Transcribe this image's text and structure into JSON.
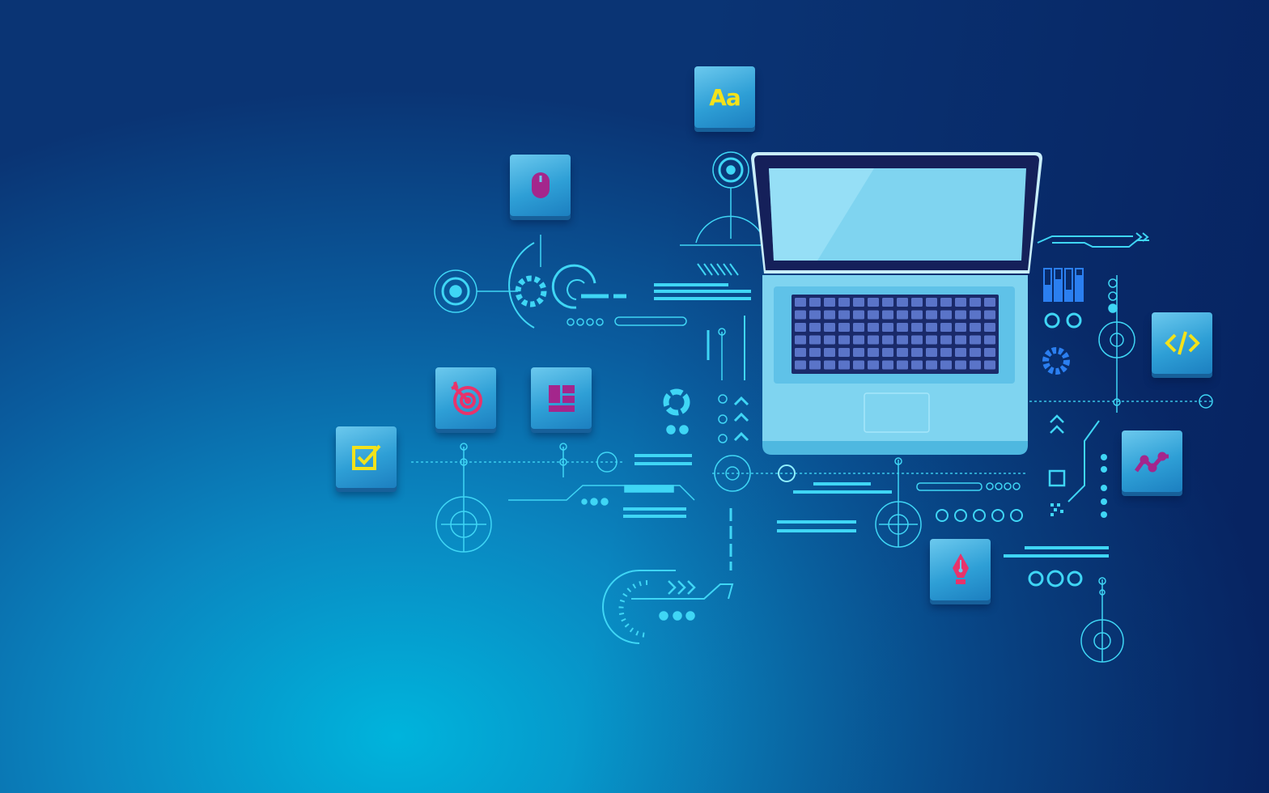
{
  "colors": {
    "background_light": "#00b4dc",
    "background_dark": "#0a3474",
    "hud_line": "#3fd6f5",
    "tile": "#3aa8dc",
    "yellow": "#f3e21a",
    "pink": "#e8336b",
    "purple": "#a4268c",
    "keyboard": "#1a2a6a",
    "screen": "#7fd4f0"
  },
  "laptop": {
    "icon": "laptop-icon"
  },
  "tiles": [
    {
      "name": "font-tile",
      "icon": "font-icon",
      "glyph": "Aa",
      "color": "#f3e21a"
    },
    {
      "name": "mouse-tile",
      "icon": "mouse-icon",
      "color": "#a4268c"
    },
    {
      "name": "target-tile",
      "icon": "target-icon",
      "color": "#e8336b"
    },
    {
      "name": "layout-tile",
      "icon": "layout-icon",
      "color": "#a4268c"
    },
    {
      "name": "checkbox-tile",
      "icon": "checkbox-icon",
      "color": "#f3e21a"
    },
    {
      "name": "code-tile",
      "icon": "code-icon",
      "color": "#f3e21a"
    },
    {
      "name": "chart-tile",
      "icon": "line-chart-icon",
      "color": "#a4268c"
    },
    {
      "name": "pen-tile",
      "icon": "pen-nib-icon",
      "color": "#e8336b"
    }
  ]
}
